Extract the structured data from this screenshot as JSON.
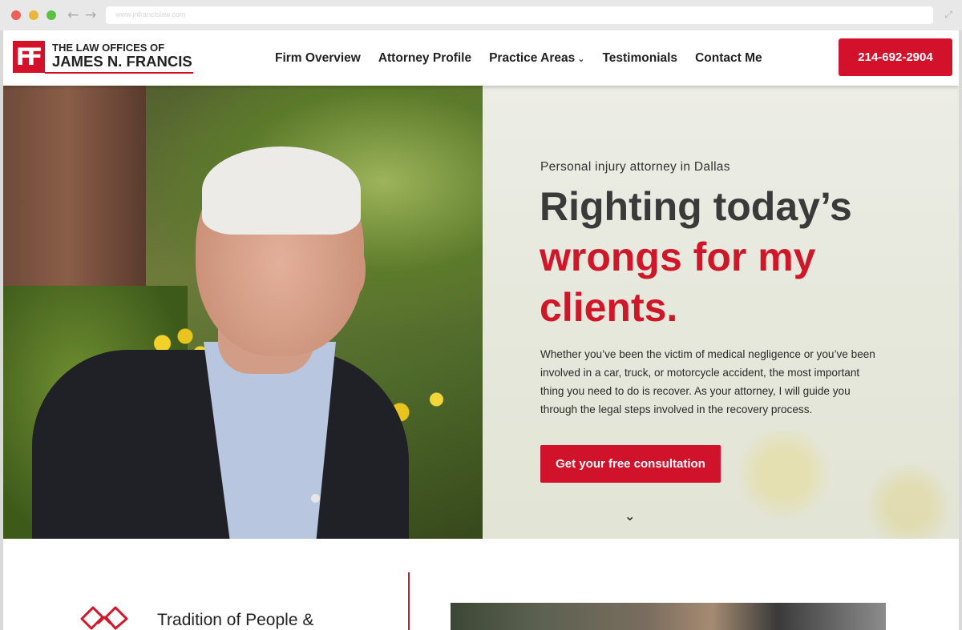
{
  "browser": {
    "url": "www.jnfrancislaw.com"
  },
  "header": {
    "logo": {
      "mark": "FF",
      "line1": "THE LAW OFFICES OF",
      "line2": "JAMES N. FRANCIS"
    },
    "nav": [
      {
        "label": "Firm Overview"
      },
      {
        "label": "Attorney Profile"
      },
      {
        "label": "Practice Areas",
        "has_dropdown": true
      },
      {
        "label": "Testimonials"
      },
      {
        "label": "Contact Me"
      }
    ],
    "phone": "214-692-2904"
  },
  "hero": {
    "eyebrow": "Personal injury attorney in Dallas",
    "title_line1": "Righting today’s",
    "title_highlight": "wrongs for my clients.",
    "body": "Whether you’ve been the victim of medical negligence or you’ve been involved in a car, truck, or motorcycle accident, the most important thing you need to do is recover. As your attorney, I will guide you through the legal steps involved in the recovery process.",
    "cta": "Get your free consultation"
  },
  "section": {
    "tradition_heading": "Tradition of People &"
  },
  "icons": {
    "back": "arrow-left-icon",
    "forward": "arrow-right-icon",
    "expand": "expand-icon",
    "dropdown": "chevron-down-icon",
    "scroll": "chevron-down-icon",
    "tradition": "handshake-icon"
  },
  "colors": {
    "brand_red": "#d4112a",
    "text_dark": "#3a3a3a"
  }
}
